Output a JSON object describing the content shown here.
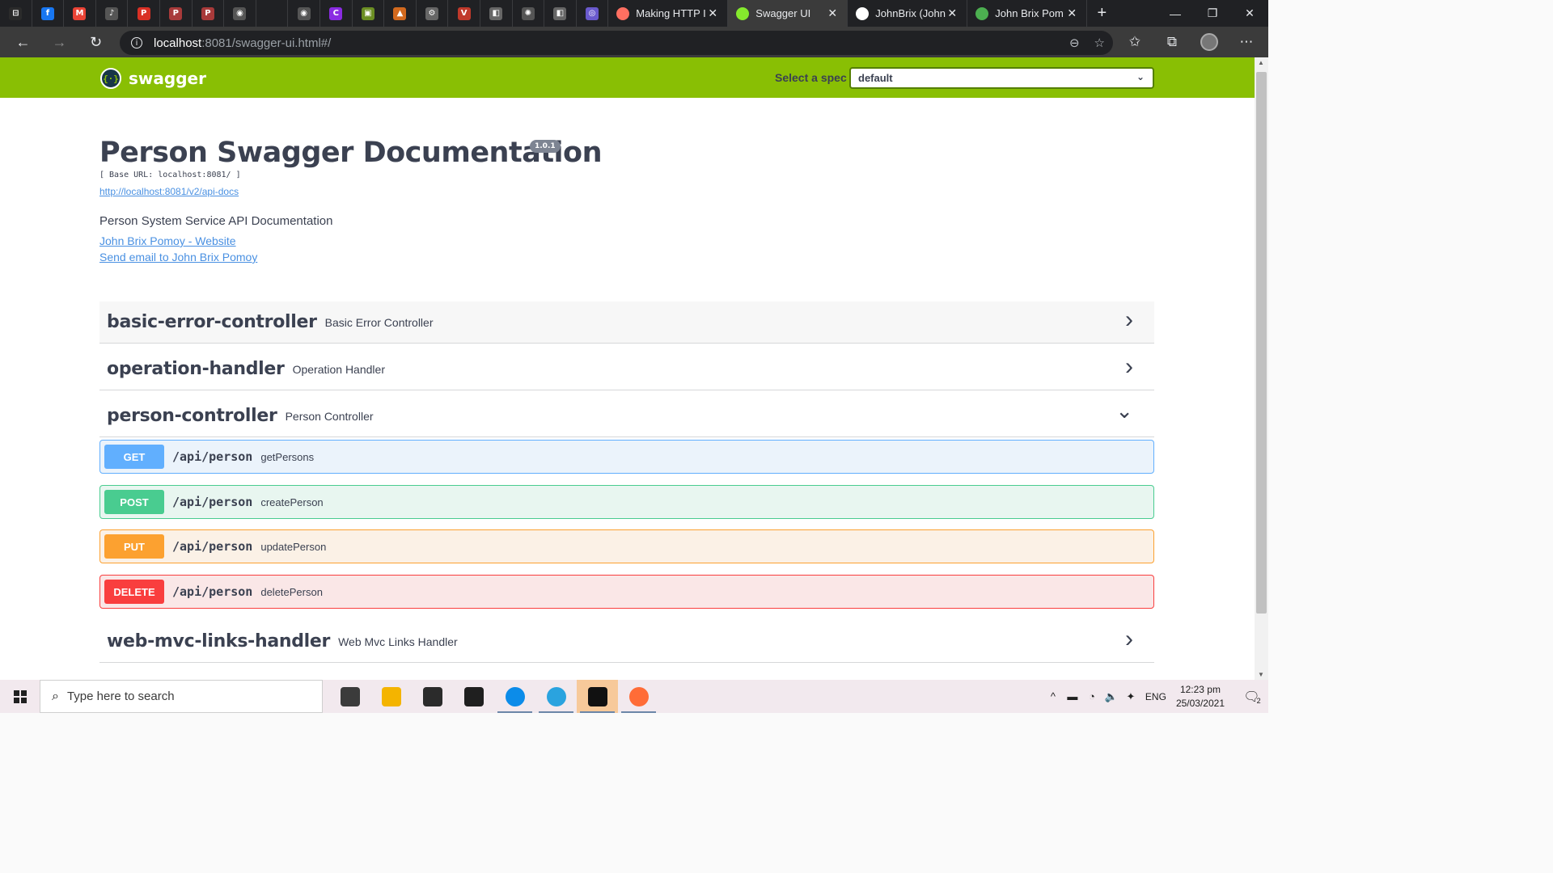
{
  "browser": {
    "pinned_tabs": [
      {
        "icon": "tab-actions-icon",
        "color": "#2b2b2b",
        "glyph": "⊟"
      },
      {
        "icon": "facebook-icon",
        "color": "#1877f2",
        "glyph": "f"
      },
      {
        "icon": "gmail-icon",
        "color": "#ea4335",
        "glyph": "M"
      },
      {
        "icon": "audio-icon",
        "color": "#555555",
        "glyph": "♪"
      },
      {
        "icon": "pdf-icon",
        "color": "#d93025",
        "glyph": "P"
      },
      {
        "icon": "pdf-icon",
        "color": "#a83a3a",
        "glyph": "P"
      },
      {
        "icon": "pdf-icon",
        "color": "#a83a3a",
        "glyph": "P"
      },
      {
        "icon": "github-icon",
        "color": "#555555",
        "glyph": "◉"
      },
      {
        "icon": "blank-icon",
        "color": "#202124",
        "glyph": ""
      },
      {
        "icon": "github-icon",
        "color": "#555555",
        "glyph": "◉"
      },
      {
        "icon": "circle-c-icon",
        "color": "#8a2be2",
        "glyph": "C"
      },
      {
        "icon": "image-icon",
        "color": "#6b8e23",
        "glyph": "▣"
      },
      {
        "icon": "chart-icon",
        "color": "#d2691e",
        "glyph": "▲"
      },
      {
        "icon": "settings-icon",
        "color": "#666666",
        "glyph": "⚙"
      },
      {
        "icon": "vector-icon",
        "color": "#c0392b",
        "glyph": "V"
      },
      {
        "icon": "doc-icon",
        "color": "#666666",
        "glyph": "◧"
      },
      {
        "icon": "openai-icon",
        "color": "#555555",
        "glyph": "✺"
      },
      {
        "icon": "doc-icon",
        "color": "#666666",
        "glyph": "◧"
      },
      {
        "icon": "globe-icon",
        "color": "#6a5acd",
        "glyph": "◎"
      }
    ],
    "tabs": [
      {
        "title": "Making HTTP I",
        "icon_color": "#ff6f61",
        "active": false
      },
      {
        "title": "Swagger UI",
        "icon_color": "#85ea2d",
        "active": true
      },
      {
        "title": "JohnBrix (John",
        "icon_color": "#ffffff",
        "active": false
      },
      {
        "title": "John Brix Pom",
        "icon_color": "#4caf50",
        "active": false
      }
    ],
    "new_tab_glyph": "+",
    "window_controls": [
      "—",
      "❐",
      "✕"
    ],
    "url_host": "localhost",
    "url_rest": ":8081/swagger-ui.html#/"
  },
  "swagger": {
    "brand": "swagger",
    "logo_glyph": "{·}",
    "spec_label": "Select a spec",
    "spec_value": "default"
  },
  "info": {
    "title": "Person Swagger Documentation",
    "version": "1.0.1",
    "base_url": "[ Base URL: localhost:8081/ ]",
    "api_docs_link": "http://localhost:8081/v2/api-docs",
    "description": "Person System Service API Documentation",
    "website_link": "John Brix Pomoy - Website",
    "email_link": "Send email to John Brix Pomoy"
  },
  "tags": [
    {
      "name": "basic-error-controller",
      "description": "Basic Error Controller",
      "expanded": false
    },
    {
      "name": "operation-handler",
      "description": "Operation Handler",
      "expanded": false
    },
    {
      "name": "person-controller",
      "description": "Person Controller",
      "expanded": true
    },
    {
      "name": "web-mvc-links-handler",
      "description": "Web Mvc Links Handler",
      "expanded": false
    }
  ],
  "operations": [
    {
      "method": "GET",
      "path": "/api/person",
      "summary": "getPersons"
    },
    {
      "method": "POST",
      "path": "/api/person",
      "summary": "createPerson"
    },
    {
      "method": "PUT",
      "path": "/api/person",
      "summary": "updatePerson"
    },
    {
      "method": "DELETE",
      "path": "/api/person",
      "summary": "deletePerson"
    }
  ],
  "taskbar": {
    "search_placeholder": "Type here to search",
    "apps": [
      {
        "icon": "task-view-icon",
        "color": "#3b3b3b"
      },
      {
        "icon": "file-explorer-icon",
        "color": "#f4b400"
      },
      {
        "icon": "store-icon",
        "color": "#2b2b2b"
      },
      {
        "icon": "mail-icon",
        "color": "#1f1f1f"
      },
      {
        "icon": "edge-icon",
        "color": "#0c8ce9"
      },
      {
        "icon": "telegram-icon",
        "color": "#2aa3df"
      },
      {
        "icon": "intellij-icon",
        "color": "#111111"
      },
      {
        "icon": "postman-icon",
        "color": "#ff6c37"
      }
    ],
    "tray_icons": [
      "^",
      "▬",
      "◔",
      "🔈",
      "✦"
    ],
    "language": "ENG",
    "time": "12:23 pm",
    "date": "25/03/2021",
    "notification_count": "2"
  }
}
